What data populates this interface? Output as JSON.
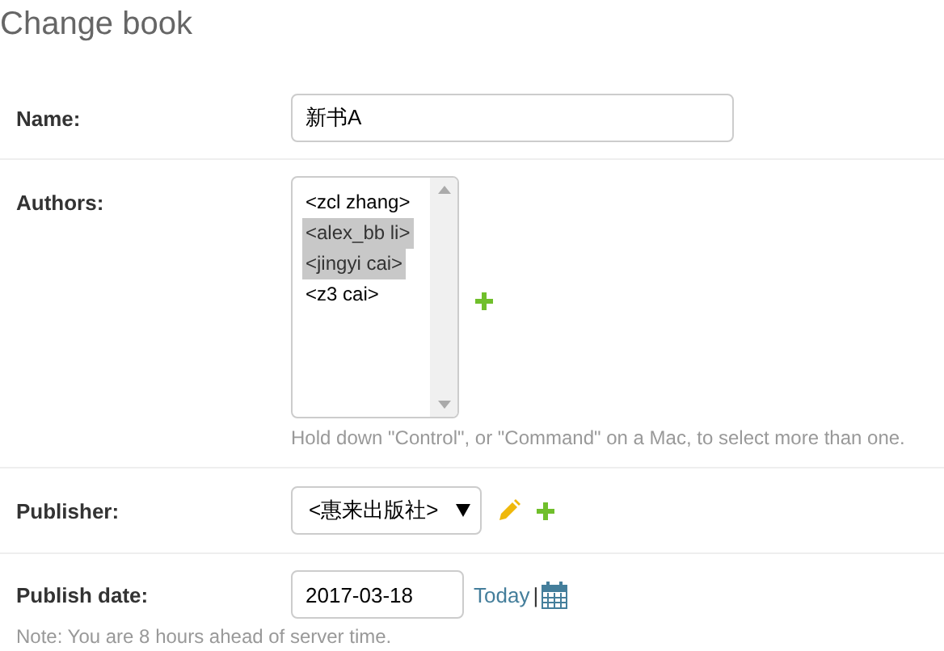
{
  "title": "Change book",
  "name": {
    "label": "Name:",
    "value": "新书A"
  },
  "authors": {
    "label": "Authors:",
    "options": [
      {
        "label": "<zcl zhang>",
        "selected": false
      },
      {
        "label": "<alex_bb li>",
        "selected": true
      },
      {
        "label": "<jingyi cai>",
        "selected": true
      },
      {
        "label": "<z3 cai>",
        "selected": false
      }
    ],
    "help": "Hold down \"Control\", or \"Command\" on a Mac, to select more than one."
  },
  "publisher": {
    "label": "Publisher:",
    "value": "<惠来出版社>"
  },
  "publish_date": {
    "label": "Publish date:",
    "value": "2017-03-18",
    "today": "Today",
    "separator": "|",
    "note": "Note: You are 8 hours ahead of server time."
  }
}
